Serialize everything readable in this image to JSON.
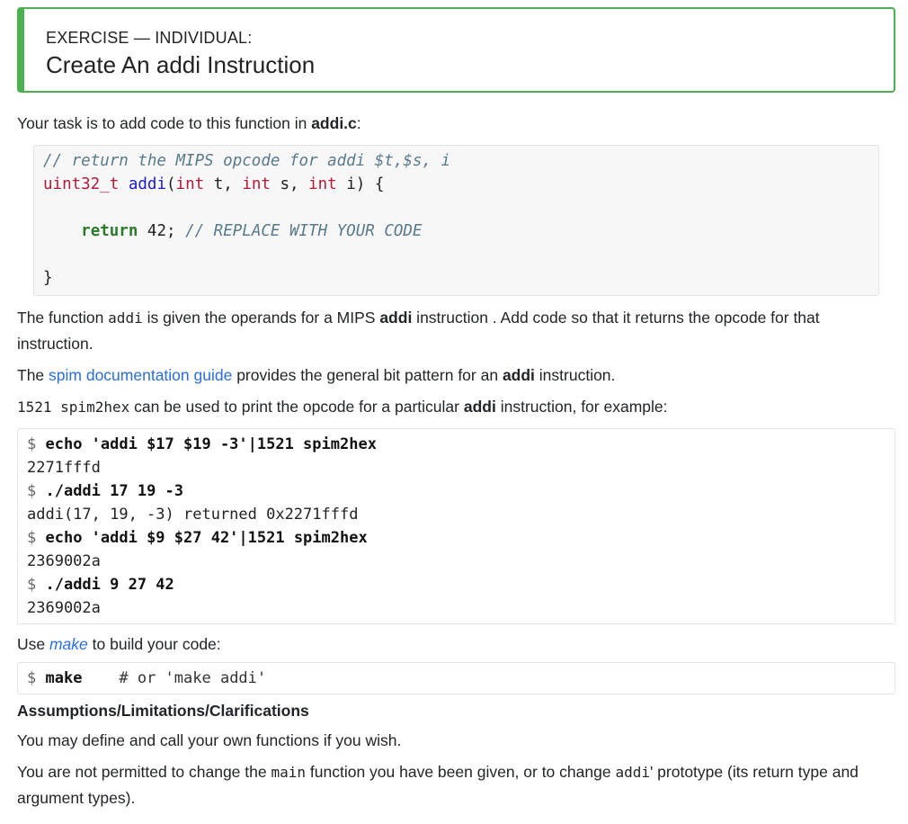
{
  "exercise": {
    "kicker": "EXERCISE — INDIVIDUAL:",
    "title": "Create An addi Instruction"
  },
  "intro": {
    "text_before": "Your task is to add code to this function in ",
    "filename": "addi.c",
    "text_after": ":"
  },
  "code": {
    "line1_comment": "// return the MIPS opcode for addi $t,$s, i",
    "line2_type": "uint32_t",
    "line2_fn": "addi",
    "line2_open": "(",
    "param1_type": "int",
    "param1_name": " t, ",
    "param2_type": "int",
    "param2_name": " s, ",
    "param3_type": "int",
    "param3_name": " i) {",
    "line4_kw": "return",
    "line4_val": " 42; ",
    "line4_comment": "// REPLACE WITH YOUR CODE",
    "line6_close": "}"
  },
  "desc": {
    "p1_a": "The function ",
    "p1_code": "addi",
    "p1_b": " is given the operands for a MIPS ",
    "p1_bold": "addi",
    "p1_c": " instruction . Add code so that it returns the opcode for that instruction."
  },
  "spim": {
    "a": "The ",
    "link": "spim documentation guide",
    "b": " provides the general bit pattern for an ",
    "bold": "addi",
    "c": " instruction."
  },
  "hex": {
    "code": "1521 spim2hex",
    "a": " can be used to print the opcode for a particular ",
    "bold": "addi",
    "b": " instruction, for example:"
  },
  "terminal": {
    "prompt": "$ ",
    "cmd1": "echo 'addi $17 $19 -3'|1521 spim2hex",
    "out1": "2271fffd",
    "cmd2": "./addi 17 19 -3",
    "out2": "addi(17, 19, -3) returned 0x2271fffd",
    "cmd3": "echo 'addi $9 $27 42'|1521 spim2hex",
    "out3": "2369002a",
    "cmd4": "./addi 9 27 42",
    "out4": "2369002a"
  },
  "use": {
    "a": "Use ",
    "link": "make",
    "b": " to build your code:"
  },
  "terminal2": {
    "prompt": "$ ",
    "cmd": "make",
    "comment": "    # or 'make addi'"
  },
  "assumptions": {
    "heading": "Assumptions/Limitations/Clarifications",
    "p1": "You may define and call your own functions if you wish.",
    "p2_a": "You are not permitted to change the ",
    "p2_code1": "main",
    "p2_b": " function you have been given, or to change ",
    "p2_code2": "addi",
    "p2_c": "' prototype (its return type and argument types)."
  }
}
